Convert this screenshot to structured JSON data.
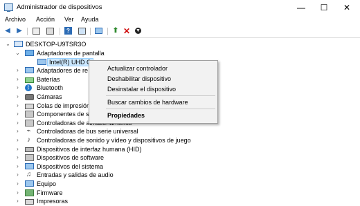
{
  "window": {
    "title": "Administrador de dispositivos",
    "controls": {
      "minimize": "—",
      "maximize": "☐",
      "close": "✕"
    }
  },
  "menu": [
    "Archivo",
    "Acción",
    "Ver",
    "Ayuda"
  ],
  "toolbar": {
    "buttons": [
      "back-icon",
      "forward-icon",
      "properties-icon",
      "show-hidden-icon",
      "help-icon",
      "action-view-icon",
      "scan-icon",
      "add-driver-icon",
      "uninstall-icon",
      "update-icon"
    ]
  },
  "tree": {
    "root": "DESKTOP-U9TSR3O",
    "items": [
      {
        "label": "Adaptadores de pantalla",
        "expanded": true,
        "icon": "display-adapter-icon"
      },
      {
        "label": "Intel(R) UHD G",
        "child": true,
        "icon": "monitor-icon"
      },
      {
        "label": "Adaptadores de re",
        "icon": "network-adapter-icon"
      },
      {
        "label": "Baterías",
        "icon": "battery-icon"
      },
      {
        "label": "Bluetooth",
        "icon": "bluetooth-icon"
      },
      {
        "label": "Cámaras",
        "icon": "camera-icon"
      },
      {
        "label": "Colas de impresión",
        "icon": "print-queue-icon"
      },
      {
        "label": "Componentes de s",
        "icon": "software-component-icon"
      },
      {
        "label": "Controladoras de almacenamiento",
        "icon": "storage-controller-icon"
      },
      {
        "label": "Controladoras de bus serie universal",
        "icon": "usb-icon"
      },
      {
        "label": "Controladoras de sonido y vídeo y dispositivos de juego",
        "icon": "sound-icon"
      },
      {
        "label": "Dispositivos de interfaz humana (HID)",
        "icon": "hid-icon"
      },
      {
        "label": "Dispositivos de software",
        "icon": "software-device-icon"
      },
      {
        "label": "Dispositivos del sistema",
        "icon": "system-device-icon"
      },
      {
        "label": "Entradas y salidas de audio",
        "icon": "audio-io-icon"
      },
      {
        "label": "Equipo",
        "icon": "computer-icon"
      },
      {
        "label": "Firmware",
        "icon": "firmware-icon"
      },
      {
        "label": "Impresoras",
        "icon": "printer-icon"
      }
    ]
  },
  "context_menu": {
    "items": [
      {
        "label": "Actualizar controlador"
      },
      {
        "label": "Deshabilitar dispositivo"
      },
      {
        "label": "Desinstalar el dispositivo"
      },
      {
        "label": "Buscar cambios de hardware"
      },
      {
        "label": "Propiedades",
        "bold": true
      }
    ]
  }
}
